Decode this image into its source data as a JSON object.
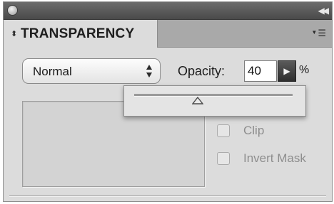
{
  "panel": {
    "tab_label": "TRANSPARENCY",
    "icons": {
      "close": "close-icon",
      "collapse": "collapse-icon",
      "tab_arrows": "updown-arrows-icon",
      "menu": "panel-menu-icon"
    },
    "colors": {
      "titlebar": "#4a4a4a",
      "panel_bg": "#dcdcdc",
      "tabstrip": "#a9a9a9"
    }
  },
  "blend": {
    "value": "Normal"
  },
  "opacity": {
    "label": "Opacity:",
    "value": "40",
    "unit": "%",
    "slider_level": 0.4
  },
  "mask": {
    "clip_label": "Clip",
    "invert_label": "Invert Mask",
    "clip_checked": false,
    "invert_checked": false
  }
}
